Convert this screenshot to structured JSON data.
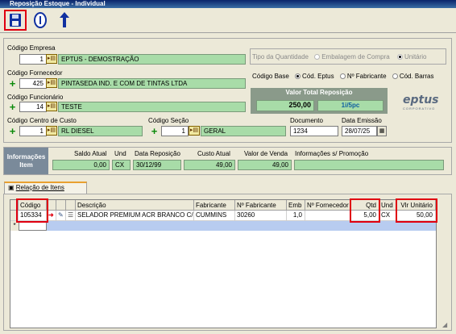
{
  "window": {
    "title": "Reposição Estoque - Individual"
  },
  "toolbar": {
    "save_icon": "floppy-disk-icon",
    "info_icon": "info-icon",
    "back_icon": "return-arrow-icon"
  },
  "empresa": {
    "label": "Código Empresa",
    "code": "1",
    "name": "EPTUS - DEMOSTRAÇÃO"
  },
  "fornecedor": {
    "label": "Código Fornecedor",
    "code": "425",
    "name": "PINTASEDA IND. E COM DE TINTAS LTDA"
  },
  "funcionario": {
    "label": "Código Funcionário",
    "code": "14",
    "name": "TESTE"
  },
  "centro_custo": {
    "label": "Código Centro de Custo",
    "code": "1",
    "name": "RL DIESEL"
  },
  "secao": {
    "label": "Código Seção",
    "code": "1",
    "name": "GERAL"
  },
  "documento": {
    "label": "Documento",
    "value": "1234"
  },
  "emissao": {
    "label": "Data Emissão",
    "value": "28/07/25"
  },
  "tipo_quantidade": {
    "label": "Tipo da Quantidade",
    "options": [
      "Embalagem de Compra",
      "Unitário"
    ],
    "selected": "Unitário"
  },
  "codigo_base": {
    "label": "Código Base",
    "options": [
      "Cód. Eptus",
      "Nº Fabricante",
      "Cód. Barras"
    ],
    "selected": "Cód. Eptus"
  },
  "valor_total": {
    "label": "Valor Total Reposição",
    "value": "250,00",
    "parcelas": "1i/5pc"
  },
  "logo": {
    "text": "eptus",
    "subtext": "CORPORATIVO"
  },
  "info_item": {
    "label_line1": "Informações",
    "label_line2": "Item",
    "saldo_label": "Saldo Atual",
    "saldo": "0,00",
    "und_label": "Und",
    "und": "CX",
    "data_label": "Data Reposição",
    "data": "30/12/99",
    "custo_label": "Custo Atual",
    "custo": "49,00",
    "venda_label": "Valor de Venda",
    "venda": "49,00",
    "promo_label": "Informações s/ Promoção",
    "promo": ""
  },
  "tab": {
    "label": "Relação de Itens"
  },
  "grid": {
    "headers": {
      "codigo": "Código",
      "descricao": "Descrição",
      "fabricante": "Fabricante",
      "nfab": "Nº Fabricante",
      "emb": "Emb",
      "nforn": "Nº Fornecedor",
      "qtd": "Qtd",
      "und": "Und",
      "vlr": "Vlr Unitário"
    },
    "rows": [
      {
        "codigo": "105334",
        "descricao": "SELADOR PREMIUM ACR BRANCO C/",
        "fabricante": "CUMMINS",
        "nfab": "30260",
        "emb": "1,0",
        "nforn": "",
        "qtd": "5,00",
        "und": "CX",
        "vlr": "50,00"
      }
    ],
    "new_row_marker": "*"
  }
}
